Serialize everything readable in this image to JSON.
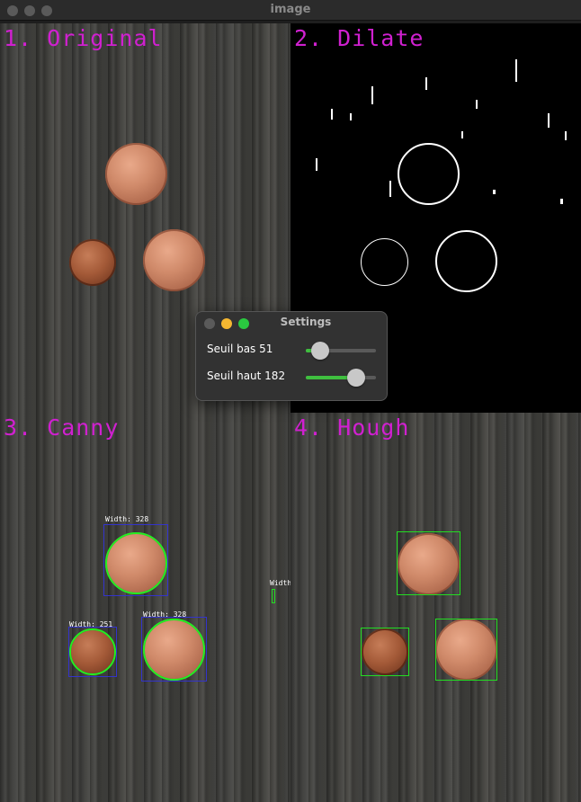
{
  "window": {
    "title": "image"
  },
  "quadrants": {
    "original": {
      "label": "1. Original"
    },
    "dilate": {
      "label": "2. Dilate"
    },
    "canny": {
      "label": "3. Canny",
      "widths": [
        "Width: 328",
        "Width: 251",
        "Width: 328",
        "Width:"
      ]
    },
    "hough": {
      "label": "4. Hough"
    }
  },
  "settings": {
    "title": "Settings",
    "sliders": [
      {
        "label": "Seuil bas 51",
        "value": 51,
        "max": 255
      },
      {
        "label": "Seuil haut 182",
        "value": 182,
        "max": 255
      }
    ],
    "colors": {
      "accent": "#3fbf3f",
      "close": "#5a5a5a",
      "minimize": "#f5b731",
      "maximize": "#2ac840"
    }
  },
  "colors": {
    "label": "#d020d0",
    "canny_box": "#3333cc",
    "hough_box": "#22dd22"
  }
}
